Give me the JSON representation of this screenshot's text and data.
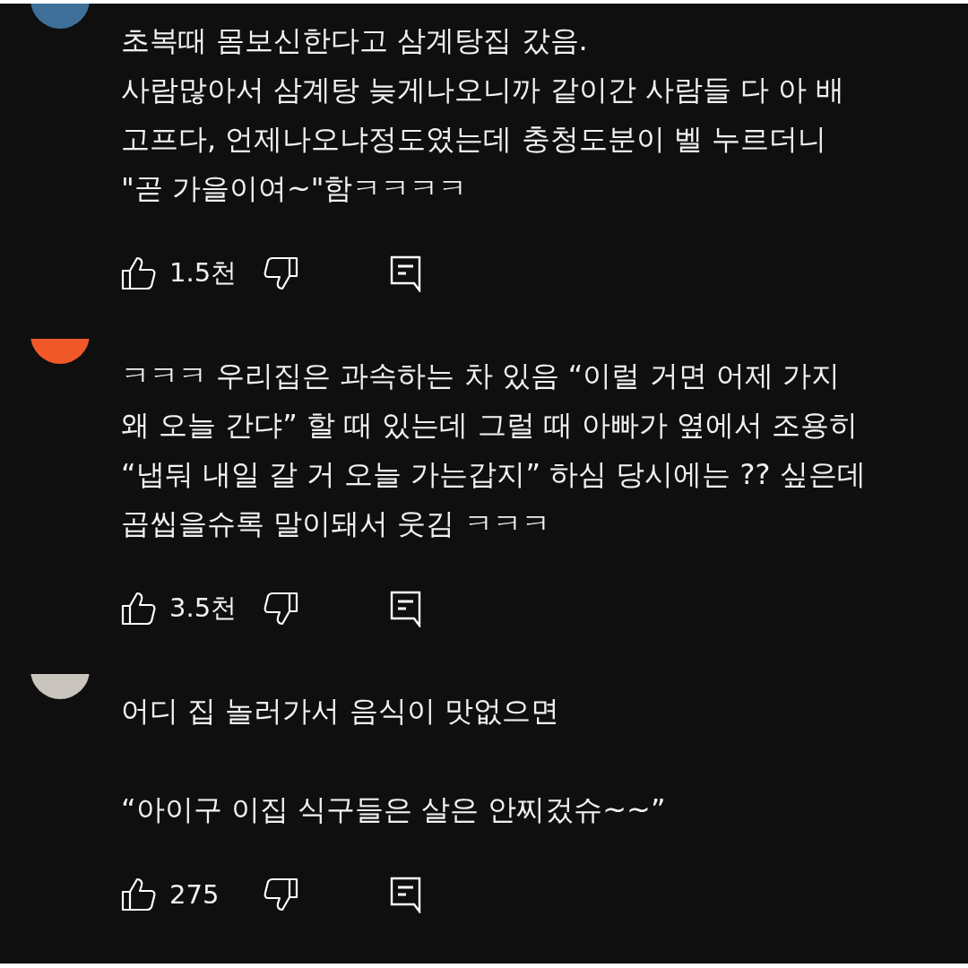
{
  "comments": [
    {
      "color": "#3d6f98",
      "text": "초복때 몸보신한다고 삼계탕집 갔음.\n사람많아서 삼계탕 늦게나오니까 같이간 사람들 다 아 배\n고프다, 언제나오냐정도였는데 충청도분이 벨 누르더니\n\"곧 가을이여~\"함ㅋㅋㅋㅋ",
      "likes": "1.5천"
    },
    {
      "color": "#f0582a",
      "text": "ㅋㅋㅋ 우리집은 과속하는 차 있음 “이럴 거면 어제 가지\n왜 오늘 간댜” 할 때 있는데 그럴 때 아빠가 옆에서 조용히\n“냅둬 내일 갈 거 오늘 가는갑지” 하심 당시에는 ?? 싶은데\n곱씹을슈록 말이돼서 웃김 ㅋㅋㅋ",
      "likes": "3.5천"
    },
    {
      "color": "#c9c5be",
      "text": "어디 집 놀러가서 음식이 맛없으면\n\n“아이구 이집 식구들은 살은 안찌겄슈~~”",
      "likes": "275"
    }
  ]
}
